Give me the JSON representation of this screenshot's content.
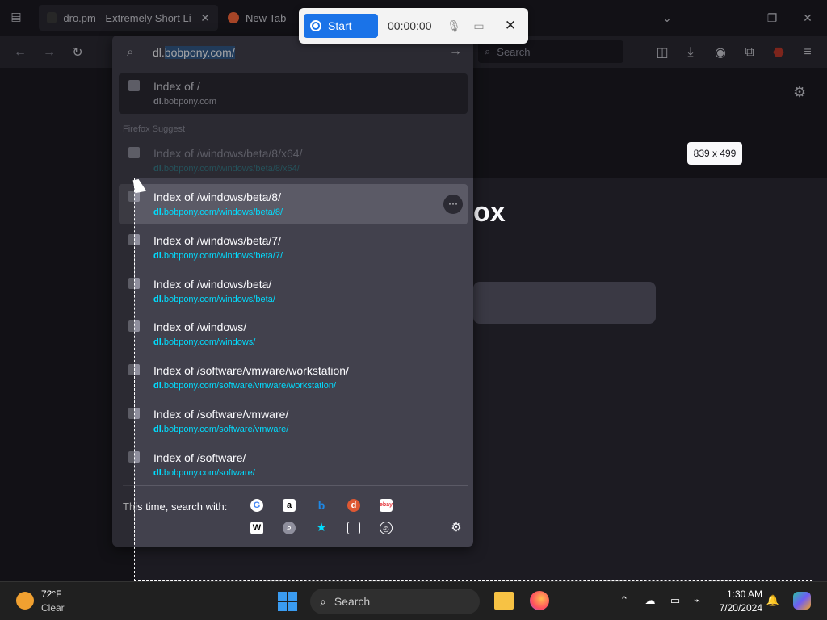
{
  "tabs": [
    {
      "label": "dro.pm - Extremely Short Links",
      "close": "✕"
    },
    {
      "label": "New Tab"
    }
  ],
  "recorder": {
    "start_label": "Start",
    "timer": "00:00:00"
  },
  "toolbar": {
    "search_placeholder": "Search"
  },
  "urlbar": {
    "typed": "dl.",
    "autofill": "bobpony.com/"
  },
  "dropdown": {
    "top_result": {
      "title": "Index of /",
      "url_bold": "dl.",
      "url_rest": "bobpony.com"
    },
    "section_label": "Firefox Suggest",
    "results": [
      {
        "title": "Index of /windows/beta/8/x64/",
        "url_bold": "dl.",
        "url_rest": "bobpony.com/windows/beta/8/x64/"
      },
      {
        "title": "Index of /windows/beta/8/",
        "url_bold": "dl.",
        "url_rest": "bobpony.com/windows/beta/8/"
      },
      {
        "title": "Index of /windows/beta/7/",
        "url_bold": "dl.",
        "url_rest": "bobpony.com/windows/beta/7/"
      },
      {
        "title": "Index of /windows/beta/",
        "url_bold": "dl.",
        "url_rest": "bobpony.com/windows/beta/"
      },
      {
        "title": "Index of /windows/",
        "url_bold": "dl.",
        "url_rest": "bobpony.com/windows/"
      },
      {
        "title": "Index of /software/vmware/workstation/",
        "url_bold": "dl.",
        "url_rest": "bobpony.com/software/vmware/workstation/"
      },
      {
        "title": "Index of /software/vmware/",
        "url_bold": "dl.",
        "url_rest": "bobpony.com/software/vmware/"
      },
      {
        "title": "Index of /software/",
        "url_bold": "dl.",
        "url_rest": "bobpony.com/software/"
      }
    ],
    "more_label": "···",
    "search_with_label": "This time, search with:",
    "engines_row1": [
      "google-icon",
      "amazon-icon",
      "bing-icon",
      "duckduckgo-icon",
      "ebay-icon"
    ],
    "engines_row2": [
      "wikipedia-icon",
      "history-search-icon",
      "bookmarks-star-icon",
      "tabs-icon",
      "history-clock-icon"
    ]
  },
  "page": {
    "logo_fragment": "ox"
  },
  "screenshot_overlay": {
    "size_label": "839 x 499"
  },
  "taskbar": {
    "weather_temp": "72°F",
    "weather_cond": "Clear",
    "search_label": "Search",
    "time": "1:30 AM",
    "date": "7/20/2024"
  }
}
